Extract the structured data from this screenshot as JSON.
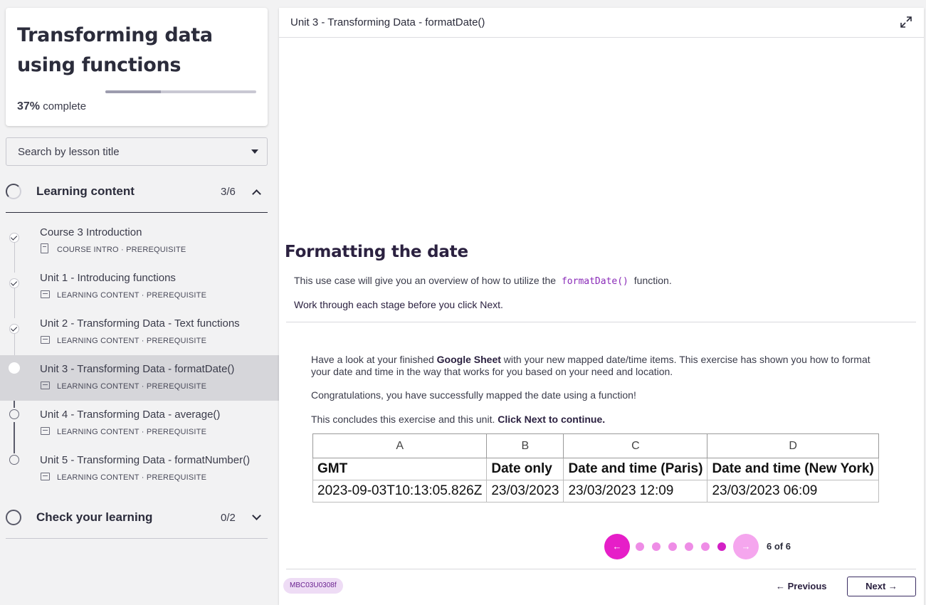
{
  "sidebar": {
    "course_title": "Transforming data using functions",
    "progress_percent": 37,
    "progress_value": "37%",
    "progress_suffix": " complete",
    "search_placeholder": "Search by lesson title",
    "sections": [
      {
        "label": "Learning content",
        "count": "3/6",
        "expanded": true,
        "lessons": [
          {
            "title": "Course 3 Introduction",
            "meta": "COURSE INTRO · PREREQUISITE",
            "status": "done"
          },
          {
            "title": "Unit 1 - Introducing functions",
            "meta": "LEARNING CONTENT · PREREQUISITE",
            "status": "done"
          },
          {
            "title": "Unit 2 - Transforming Data - Text functions",
            "meta": "LEARNING CONTENT · PREREQUISITE",
            "status": "done"
          },
          {
            "title": "Unit 3 - Transforming Data - formatDate()",
            "meta": "LEARNING CONTENT · PREREQUISITE",
            "status": "current"
          },
          {
            "title": "Unit 4 - Transforming Data - average()",
            "meta": "LEARNING CONTENT · PREREQUISITE",
            "status": "todo"
          },
          {
            "title": "Unit 5 - Transforming Data - formatNumber()",
            "meta": "LEARNING CONTENT · PREREQUISITE",
            "status": "todo"
          }
        ]
      },
      {
        "label": "Check your learning",
        "count": "0/2",
        "expanded": false
      }
    ]
  },
  "main": {
    "topbar_title": "Unit 3 - Transforming Data - formatDate()",
    "heading": "Formatting the date",
    "intro_before": "This use case will give you an overview of how to utilize the ",
    "intro_code": "formatDate()",
    "intro_after": " function.",
    "work_text": "Work through each stage before you click Next",
    "work_period": ".",
    "p1_a": "Have a look at your finished ",
    "p1_b": "Google Sheet",
    "p1_c": " with your new mapped date/time items. This exercise has shown you how to format your date and time in the way that works for you based on your need and location.",
    "p2": "Congratulations, you have successfully mapped the date using a function!",
    "p3_a": "This concludes this exercise and this unit. ",
    "p3_b": "Click Next to continue.",
    "sheet": {
      "columns": [
        "A",
        "B",
        "C",
        "D"
      ],
      "header": [
        "GMT",
        "Date only",
        "Date and time (Paris)",
        "Date and time (New York)"
      ],
      "row": [
        "2023-09-03T10:13:05.826Z",
        "23/03/2023",
        "23/03/2023 12:09",
        "23/03/2023 06:09"
      ]
    },
    "pager": {
      "prev_arrow": "←",
      "next_arrow": "→",
      "total_steps": 6,
      "current_step": 6,
      "label": "6 of 6"
    },
    "code_badge": "MBC03U0308f",
    "prev_label": "← Previous",
    "next_label": "Next →",
    "colors": {
      "accent": "#e61ec8",
      "accent_light": "#f5a6ee",
      "dot": "#ee8de6",
      "dot_active": "#d320c5",
      "badge_bg": "#eedcf5"
    }
  }
}
